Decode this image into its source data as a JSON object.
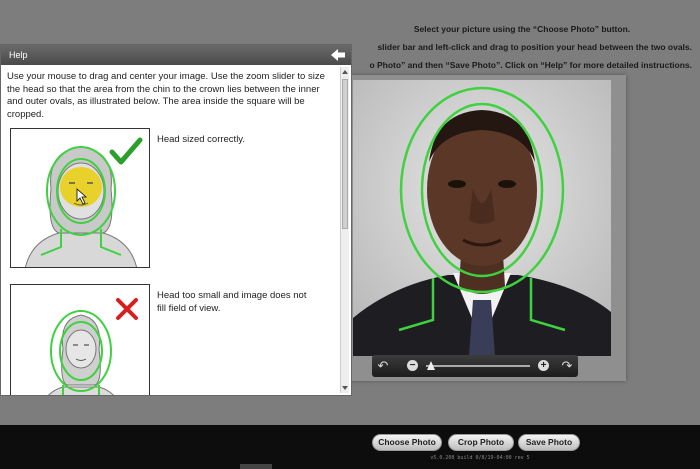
{
  "instructions": {
    "line1": "Select your picture using the “Choose Photo” button.",
    "line2": "slider bar and left-click and drag to position your head between the two ovals.",
    "line3": "o Photo” and then “Save Photo”.  Click on “Help” for more detailed instructions."
  },
  "help": {
    "title": "Help",
    "intro": "Use your mouse to drag and center your image.  Use the zoom slider to size the head so that the area from the chin to the crown lies between the inner and outer ovals, as illustrated below. The area inside the square will be cropped.",
    "examples": [
      {
        "caption": "Head sized correctly.",
        "status": "correct"
      },
      {
        "caption": "Head too small and image does not fill field of view.",
        "status": "incorrect"
      }
    ]
  },
  "zoom": {
    "level": 0.05,
    "minus_label": "−",
    "plus_label": "+"
  },
  "buttons": {
    "choose": "Choose Photo",
    "crop": "Crop Photo",
    "save": "Save Photo"
  },
  "version": "v5.0.208 build 0/8/19-04:00 rev 5",
  "colors": {
    "oval": "#3fd13f",
    "check": "#2aa02a",
    "cross": "#d62020",
    "highlight": "#e8d020"
  }
}
